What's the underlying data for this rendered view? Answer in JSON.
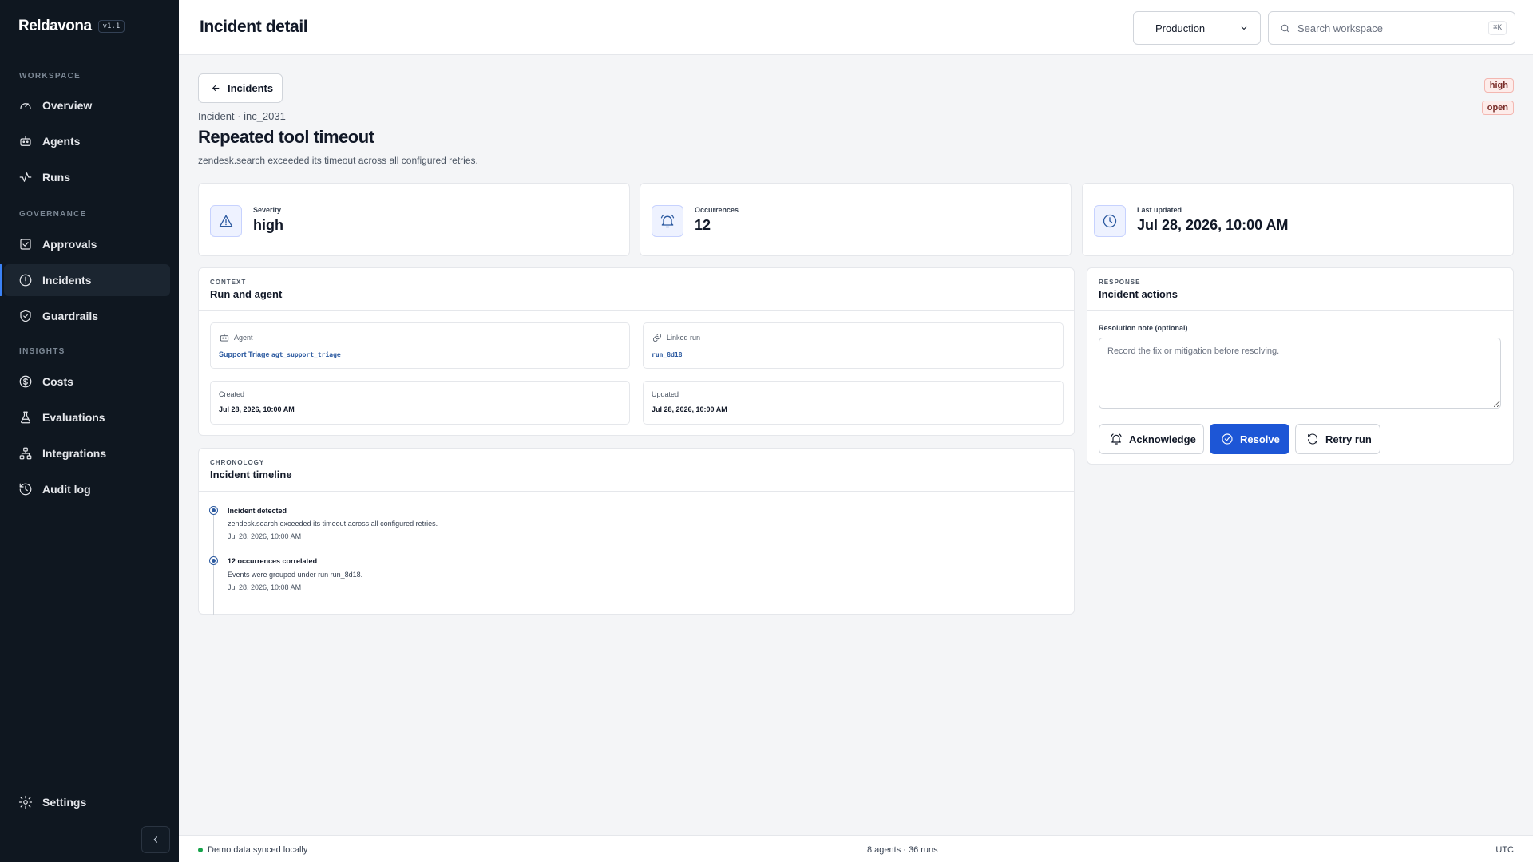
{
  "app": {
    "name": "Reldavona",
    "version": "v1.1"
  },
  "sidebar": {
    "sections": [
      {
        "label": "WORKSPACE"
      },
      {
        "label": "GOVERNANCE"
      },
      {
        "label": "INSIGHTS"
      }
    ],
    "items": [
      {
        "label": "Overview",
        "icon": "gauge-icon"
      },
      {
        "label": "Agents",
        "icon": "robot-icon"
      },
      {
        "label": "Runs",
        "icon": "activity-icon"
      },
      {
        "label": "Approvals",
        "icon": "checkbox-icon"
      },
      {
        "label": "Incidents",
        "icon": "alert-circle-icon",
        "active": true
      },
      {
        "label": "Guardrails",
        "icon": "shield-check-icon"
      },
      {
        "label": "Costs",
        "icon": "dollar-circle-icon"
      },
      {
        "label": "Evaluations",
        "icon": "flask-icon"
      },
      {
        "label": "Integrations",
        "icon": "network-icon"
      },
      {
        "label": "Audit log",
        "icon": "history-icon"
      }
    ],
    "settings_label": "Settings"
  },
  "header": {
    "title": "Incident detail",
    "environment": "Production",
    "search_placeholder": "Search workspace",
    "search_shortcut": "⌘K"
  },
  "incident": {
    "back_label": "Incidents",
    "breadcrumb": "Incident · inc_2031",
    "title": "Repeated tool timeout",
    "description": "zendesk.search exceeded its timeout across all configured retries.",
    "severity_badge": "high",
    "status_badge": "open",
    "stats": [
      {
        "label": "Severity",
        "value": "high"
      },
      {
        "label": "Occurrences",
        "value": "12"
      },
      {
        "label": "Last updated",
        "value": "Jul 28, 2026, 10:00 AM"
      }
    ]
  },
  "context": {
    "kicker": "CONTEXT",
    "title": "Run and agent",
    "agent_label": "Agent",
    "agent_name": "Support Triage",
    "agent_id": "agt_support_triage",
    "linked_run_label": "Linked run",
    "linked_run": "run_8d18",
    "created_label": "Created",
    "created_value": "Jul 28, 2026, 10:00 AM",
    "updated_label": "Updated",
    "updated_value": "Jul 28, 2026, 10:00 AM"
  },
  "timeline": {
    "kicker": "CHRONOLOGY",
    "title": "Incident timeline",
    "events": [
      {
        "title": "Incident detected",
        "description": "zendesk.search exceeded its timeout across all configured retries.",
        "time": "Jul 28, 2026, 10:00 AM"
      },
      {
        "title": "12 occurrences correlated",
        "description": "Events were grouped under run run_8d18.",
        "time": "Jul 28, 2026, 10:08 AM"
      }
    ]
  },
  "response": {
    "kicker": "RESPONSE",
    "title": "Incident actions",
    "note_label": "Resolution note (optional)",
    "note_placeholder": "Record the fix or mitigation before resolving.",
    "acknowledge_label": "Acknowledge",
    "resolve_label": "Resolve",
    "retry_label": "Retry run"
  },
  "footer": {
    "sync_status": "Demo data synced locally",
    "counts": "8 agents · 36 runs",
    "timezone": "UTC"
  },
  "colors": {
    "sidebar_bg": "#0f1720",
    "accent": "#1d56d6",
    "badge_bg": "#fdecea",
    "status_ok": "#16a34a"
  }
}
